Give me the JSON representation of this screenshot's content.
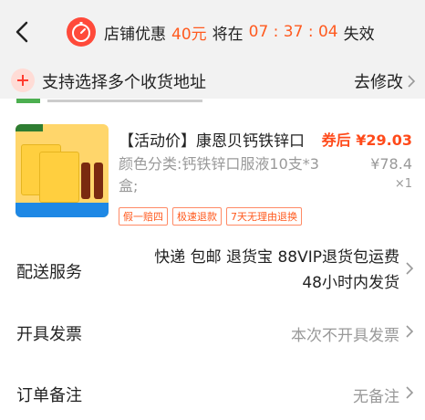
{
  "header": {
    "promo_label": "店铺优惠",
    "promo_amount": "40元",
    "middle": "将在",
    "countdown": "07 : 37 : 04",
    "expire": "失效"
  },
  "address": {
    "notice": "支持选择多个收货地址",
    "action": "去修改"
  },
  "product": {
    "title": "【活动价】康恩贝钙铁锌口",
    "price_label": "券后 ¥29.03",
    "sku": "颜色分类:钙铁锌口服液10支*3盒;",
    "original_price": "¥78.4",
    "quantity": "×1",
    "badges": [
      "假一赔四",
      "极速退款",
      "7天无理由退换"
    ]
  },
  "rows": {
    "shipping_label": "配送服务",
    "shipping_line1": "快递 包邮 退货宝 88VIP退货包运费",
    "shipping_line2": "48小时内发货",
    "invoice_label": "开具发票",
    "invoice_value": "本次不开具发票",
    "note_label": "订单备注",
    "note_value": "无备注"
  },
  "colors": {
    "accent": "#ff5a1f",
    "header_bg": "#f2f2f2",
    "muted": "#999999"
  },
  "icons": {
    "back": "chevron-left-icon",
    "timer": "stopwatch-icon",
    "add": "plus-icon",
    "more": "chevron-right-icon"
  }
}
